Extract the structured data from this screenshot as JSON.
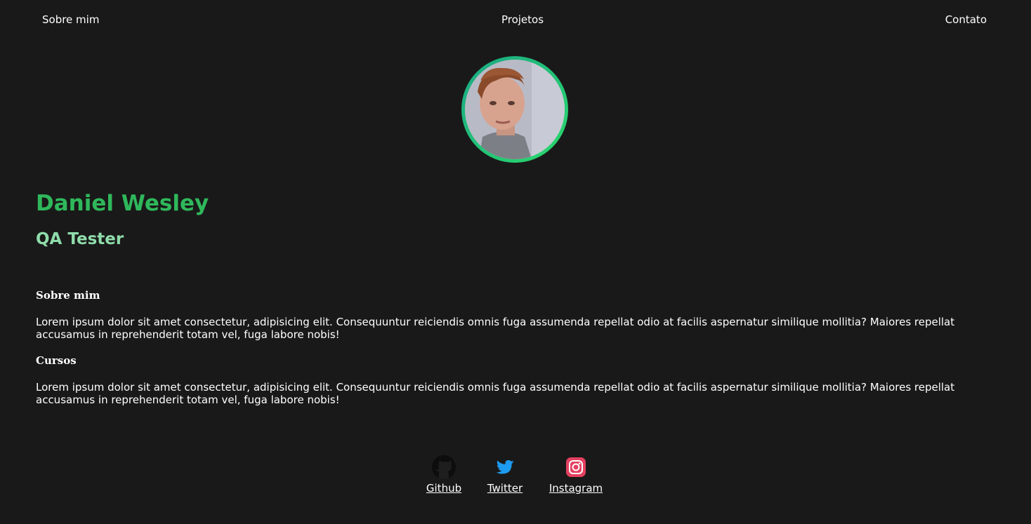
{
  "nav": {
    "about": "Sobre mim",
    "projects": "Projetos",
    "contact": "Contato"
  },
  "profile": {
    "name": "Daniel Wesley",
    "role": "QA Tester"
  },
  "sections": [
    {
      "title": "Sobre mim",
      "text": "Lorem ipsum dolor sit amet consectetur, adipisicing elit. Consequuntur reiciendis omnis fuga assumenda repellat odio at facilis aspernatur similique mollitia? Maiores repellat accusamus in reprehenderit totam vel, fuga labore nobis!"
    },
    {
      "title": "Cursos",
      "text": "Lorem ipsum dolor sit amet consectetur, adipisicing elit. Consequuntur reiciendis omnis fuga assumenda repellat odio at facilis aspernatur similique mollitia? Maiores repellat accusamus in reprehenderit totam vel, fuga labore nobis!"
    }
  ],
  "social": [
    {
      "label": "Github",
      "icon": "github-icon"
    },
    {
      "label": "Twitter",
      "icon": "twitter-icon"
    },
    {
      "label": "Instagram",
      "icon": "instagram-icon"
    }
  ],
  "colors": {
    "background": "#191919",
    "name": "#2fb85b",
    "role": "#8fdcab",
    "avatar_ring_start": "#1aa884",
    "avatar_ring_end": "#2bd96b",
    "twitter": "#1d9bf0",
    "instagram": "#e4405f"
  }
}
